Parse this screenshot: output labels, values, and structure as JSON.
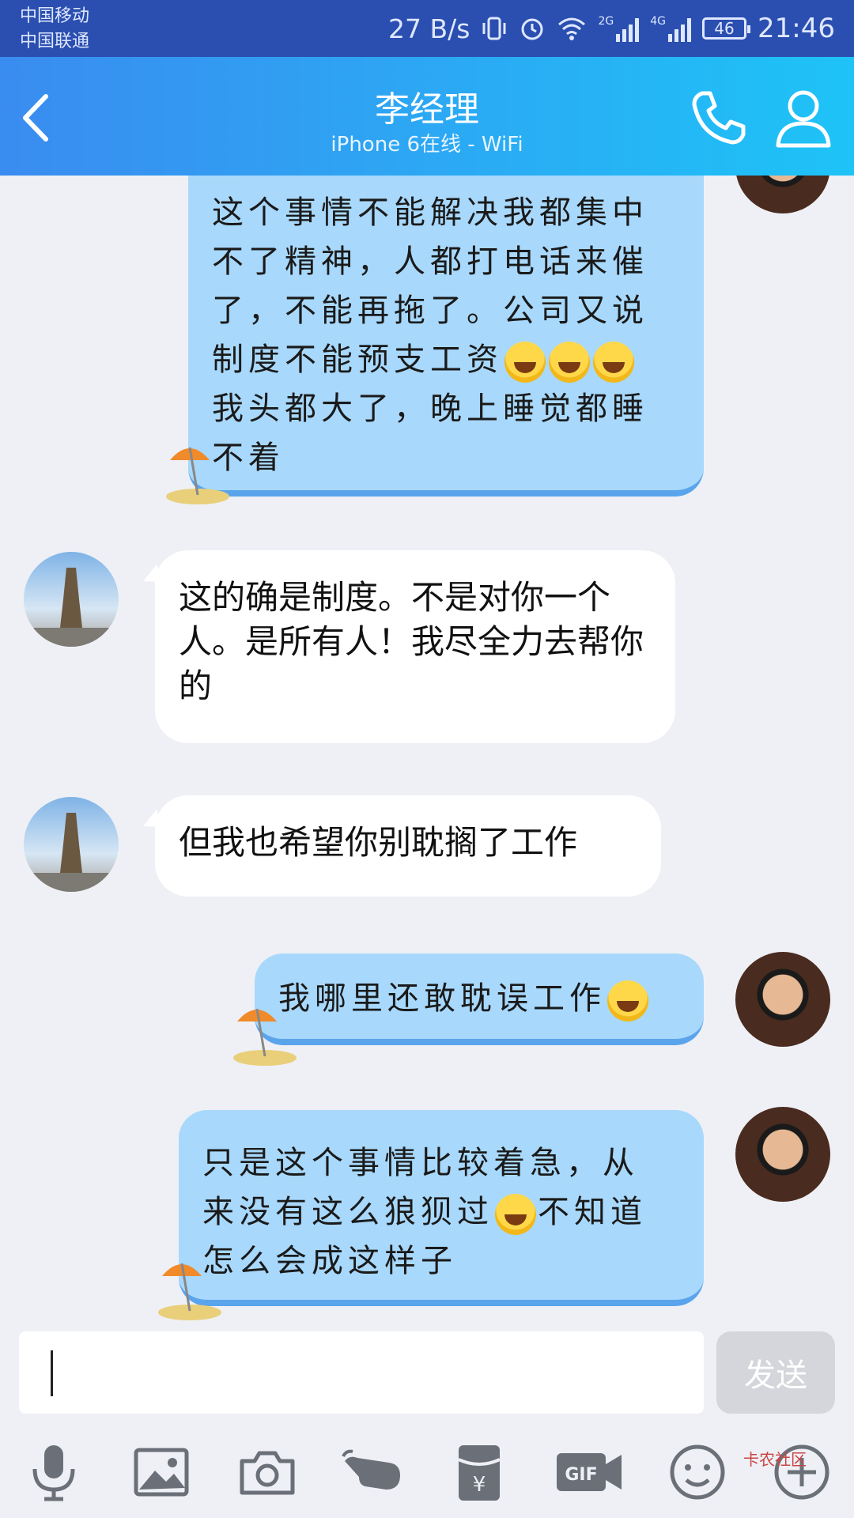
{
  "status_bar": {
    "carrier_1": "中国移动",
    "carrier_2": "中国联通",
    "net_speed": "27 B/s",
    "battery": "46",
    "time": "21:46",
    "sig_2g": "2G",
    "sig_4g": "4G"
  },
  "header": {
    "title": "李经理",
    "subtitle": "iPhone 6在线 - WiFi"
  },
  "messages": [
    {
      "side": "right",
      "lines": [
        "这个事情不能解决我都集中",
        "不了精神，人都打电话来催",
        "了，不能再拖了。公司又说",
        "制度不能预支工资",
        "我头都大了，晚上睡觉都睡",
        "不着"
      ]
    },
    {
      "side": "left",
      "text": "这的确是制度。不是对你一个人。是所有人！我尽全力去帮你的"
    },
    {
      "side": "left",
      "text": "但我也希望你别耽搁了工作"
    },
    {
      "side": "right",
      "lines": [
        "我哪里还敢耽误工作"
      ]
    },
    {
      "side": "right",
      "lines": [
        "只是这个事情比较着急，从",
        "来没有这么狼狈过",
        "不知道",
        "怎么会成这样子"
      ]
    }
  ],
  "input": {
    "send_label": "发送"
  },
  "toolbar": {
    "icons": [
      "microphone-icon",
      "image-icon",
      "camera-icon",
      "poke-icon",
      "red-packet-icon",
      "gif-icon",
      "emoji-icon",
      "plus-icon"
    ],
    "gif_label": "GIF",
    "yen_label": "¥"
  },
  "watermark": "卡农社区"
}
